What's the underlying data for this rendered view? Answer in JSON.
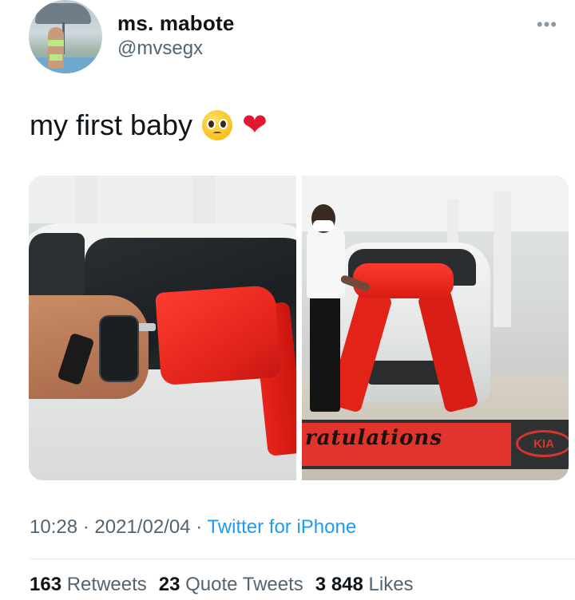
{
  "user": {
    "display_name": "ms. mabote",
    "handle": "@mvsegx"
  },
  "tweet": {
    "text": "my first baby",
    "emojis": [
      "pleading-face-icon",
      "red-heart-icon"
    ],
    "images": [
      {
        "name": "tweet-photo-1"
      },
      {
        "name": "tweet-photo-2",
        "mat_text": "ratulations",
        "brand_text": "KIA"
      }
    ]
  },
  "meta": {
    "time": "10:28",
    "date": "2021/02/04",
    "source": "Twitter for iPhone",
    "separator": "·"
  },
  "stats": {
    "retweets_count": "163",
    "retweets_label": "Retweets",
    "quote_count": "23",
    "quote_label": "Quote Tweets",
    "likes_count": "3 848",
    "likes_label": "Likes"
  },
  "colors": {
    "link": "#1d9bf0",
    "secondary_text": "#536471",
    "heart": "#e0192e"
  }
}
